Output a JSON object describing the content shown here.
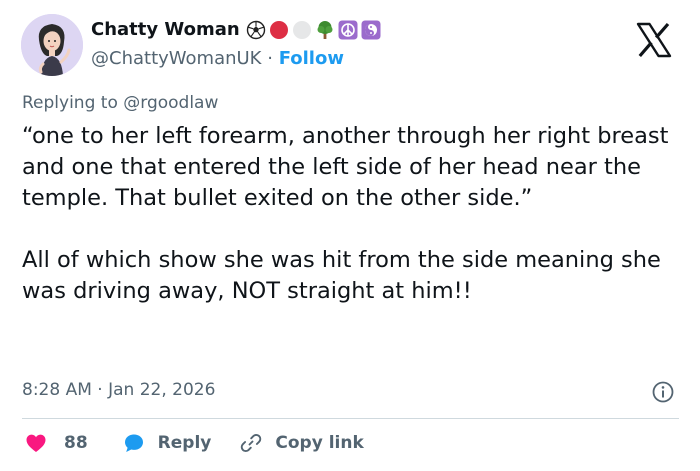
{
  "author": {
    "display_name": "Chatty Woman",
    "handle": "@ChattyWomanUK",
    "separator": "·",
    "follow_label": "Follow",
    "avatar_icon": "cartoon-woman-avatar-icon",
    "name_emojis": [
      "soccer-ball-icon",
      "red-circle-icon",
      "white-circle-icon",
      "tree-icon",
      "peace-symbol-icon",
      "yin-yang-icon"
    ]
  },
  "brand_icon": "x-logo-icon",
  "replying_to": {
    "prefix": "Replying to",
    "mention": "@rgoodlaw"
  },
  "post": {
    "paragraph_1": "“one to her left forearm, another through her right breast and one that entered the left side of her head near the temple. That bullet exited on the other side.”",
    "paragraph_2": "All of which show she was hit from the side meaning she was driving away, NOT straight at him!!"
  },
  "meta": {
    "time": "8:28 AM",
    "separator": "·",
    "date": "Jan 22, 2026",
    "info_icon": "info-icon"
  },
  "actions": {
    "like_count": "88",
    "reply_label": "Reply",
    "copy_link_label": "Copy link",
    "heart_icon": "heart-icon",
    "reply_icon": "speech-bubble-icon",
    "link_icon": "link-icon"
  },
  "colors": {
    "accent": "#1d9bf0",
    "text": "#0f1419",
    "muted": "#536471",
    "like": "#f91880",
    "divider": "#cfd9de"
  }
}
